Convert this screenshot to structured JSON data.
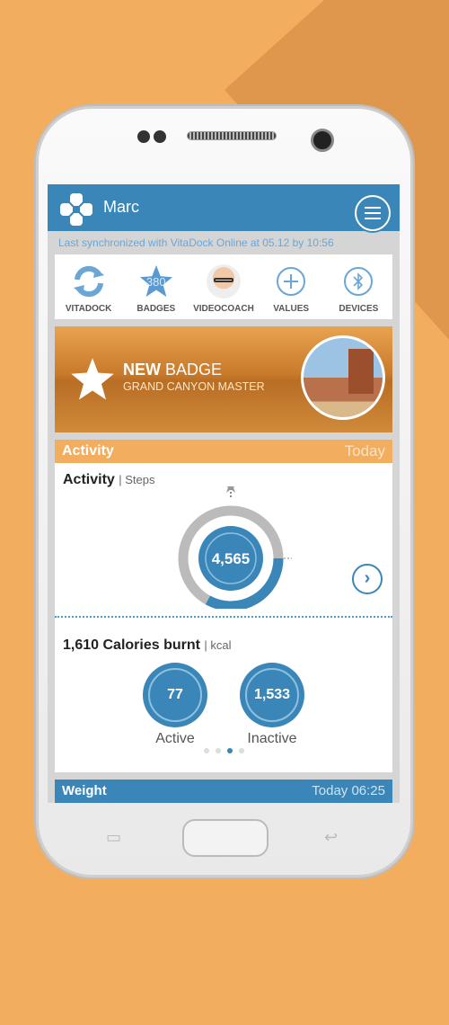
{
  "colors": {
    "primary": "#3A86B8",
    "accent": "#F2AE5E",
    "background": "#F2AE5E"
  },
  "header": {
    "user_name": "Marc",
    "menu_icon": "hamburger-icon"
  },
  "sync_status": "Last synchronized with VitaDock Online at 05.12 by 10:56",
  "quick_actions": [
    {
      "label": "VITADOCK",
      "icon": "sync-icon"
    },
    {
      "label": "BADGES",
      "icon": "star-icon",
      "count": "380"
    },
    {
      "label": "VIDEOCOACH",
      "icon": "avatar"
    },
    {
      "label": "VALUES",
      "icon": "plus-icon"
    },
    {
      "label": "DEVICES",
      "icon": "bluetooth-icon"
    }
  ],
  "badge_banner": {
    "title_bold": "NEW",
    "title_rest": " BADGE",
    "subtitle": "GRAND CANYON MASTER"
  },
  "activity": {
    "header": "Activity",
    "period": "Today",
    "title": "Activity",
    "unit": "| Steps",
    "steps": "4,565",
    "ring_progress": 0.33
  },
  "calories": {
    "title": "1,610 Calories burnt",
    "unit": "| kcal",
    "active_value": "77",
    "active_label": "Active",
    "inactive_value": "1,533",
    "inactive_label": "Inactive",
    "page_index": 2,
    "page_count": 4
  },
  "weight": {
    "header": "Weight",
    "time": "Today 06:25"
  }
}
